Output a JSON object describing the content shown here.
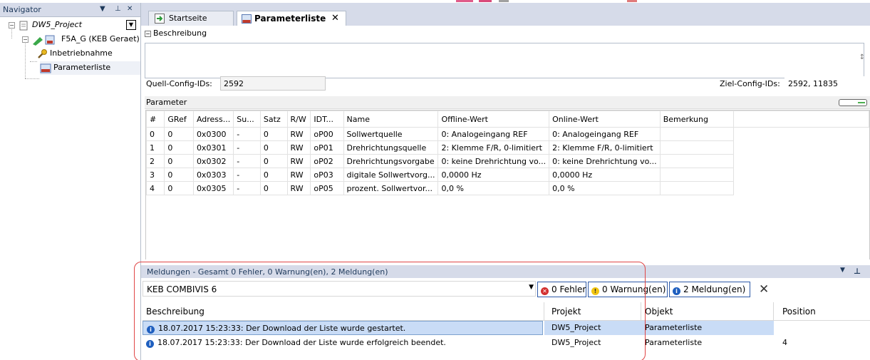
{
  "navigator": {
    "title": "Navigator",
    "pin_icon": "pin-icon",
    "tree": [
      {
        "label": "DW5_Project",
        "icon": "project-icon"
      },
      {
        "label": "F5A_G (KEB Geraet)",
        "icon": "device-icon"
      },
      {
        "label": "Inbetriebnahme",
        "icon": "wrench-icon"
      },
      {
        "label": "Parameterliste",
        "icon": "keb-list-icon"
      }
    ]
  },
  "tabs": [
    {
      "label": "Startseite"
    },
    {
      "label": "Parameterliste",
      "close": "x"
    }
  ],
  "editor": {
    "beschreibung_header": "Beschreibung",
    "quell_label": "Quell-Config-IDs:",
    "quell_value": "2592",
    "ziel_label": "Ziel-Config-IDs:",
    "ziel_value": "2592, 11835",
    "parameter_header": "Parameter",
    "columns": [
      "#",
      "GRef",
      "Adress...",
      "Su...",
      "Satz",
      "R/W",
      "IDT...",
      "Name",
      "Offline-Wert",
      "Online-Wert",
      "Bemerkung"
    ],
    "rows": [
      [
        "0",
        "0",
        "0x0300",
        "-",
        "0",
        "RW",
        "oP00",
        "Sollwertquelle",
        "0: Analogeingang REF",
        "0: Analogeingang REF",
        ""
      ],
      [
        "1",
        "0",
        "0x0301",
        "-",
        "0",
        "RW",
        "oP01",
        "Drehrichtungsquelle",
        "2: Klemme F/R, 0-limitiert",
        "2: Klemme F/R, 0-limitiert",
        ""
      ],
      [
        "2",
        "0",
        "0x0302",
        "-",
        "0",
        "RW",
        "oP02",
        "Drehrichtungsvorgabe",
        "0: keine Drehrichtung vo...",
        "0: keine Drehrichtung vo...",
        ""
      ],
      [
        "3",
        "0",
        "0x0303",
        "-",
        "0",
        "RW",
        "oP03",
        "digitale Sollwertvorg...",
        "0,0000 Hz",
        "0,0000 Hz",
        ""
      ],
      [
        "4",
        "0",
        "0x0305",
        "-",
        "0",
        "RW",
        "oP05",
        "prozent. Sollwertvor...",
        "0,0 %",
        "0,0 %",
        ""
      ]
    ]
  },
  "messages": {
    "header": "Meldungen - Gesamt 0 Fehler, 0 Warnung(en), 2 Meldung(en)",
    "source": "KEB COMBIVIS 6",
    "filter_errors": "0 Fehler",
    "filter_warnings": "0 Warnung(en)",
    "filter_messages": "2 Meldung(en)",
    "columns": {
      "desc": "Beschreibung",
      "project": "Projekt",
      "object": "Objekt",
      "position": "Position"
    },
    "rows": [
      {
        "desc": "18.07.2017 15:23:33:  Der Download der Liste wurde gestartet.",
        "project": "DW5_Project",
        "object": "Parameterliste",
        "position": ""
      },
      {
        "desc": "18.07.2017 15:23:33:  Der Download der Liste wurde erfolgreich beendet.",
        "project": "DW5_Project",
        "object": "Parameterliste",
        "position": "4"
      }
    ]
  },
  "colors": {
    "header_bg": "#d6dbe9",
    "header_text": "#1e395b",
    "selection_bg": "#c9dcf6",
    "highlight_box": "#e04545"
  }
}
